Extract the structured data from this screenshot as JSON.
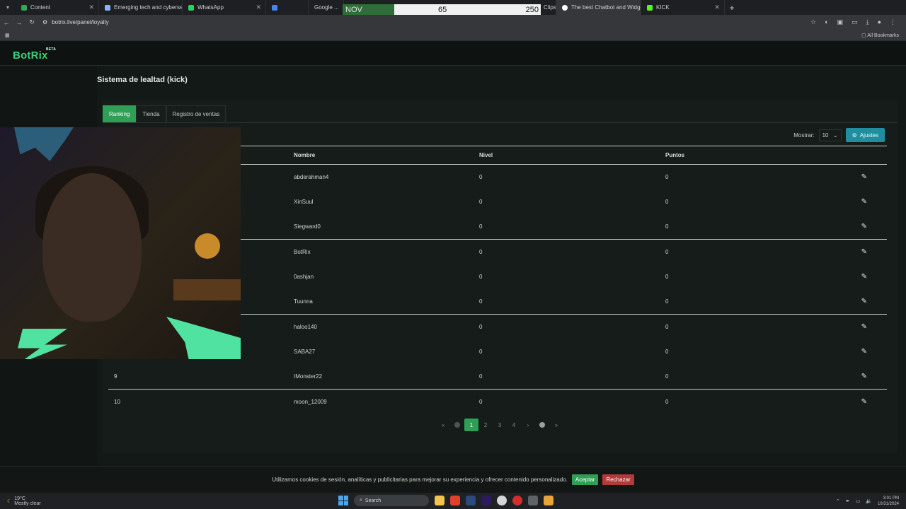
{
  "browser": {
    "tabs": [
      {
        "label": "Content",
        "color": "#34a853",
        "active": false
      },
      {
        "label": "Emerging tech and cybersecur...",
        "color": "#8ab4f8",
        "active": false
      },
      {
        "label": "WhatsApp",
        "color": "#25d366",
        "active": false
      },
      {
        "label": "",
        "color": "#4285f4",
        "active": false
      },
      {
        "label": "Google ...",
        "color": "#aaaaaa",
        "active": false
      },
      {
        "label": "Clips - Watch Live on ...",
        "color": "#53fc18",
        "active": false
      },
      {
        "label": "The best Chatbot and Widgets",
        "color": "#ffffff",
        "active": true
      },
      {
        "label": "KICK",
        "color": "#53fc18",
        "active": false
      }
    ],
    "url": "botrix.live/panel/loyalty",
    "all_bookmarks": "All Bookmarks"
  },
  "overlay": {
    "month": "NOV",
    "value_a": "65",
    "value_b": "250"
  },
  "app": {
    "logo": "BotRix",
    "logo_badge": "BETA"
  },
  "page": {
    "title": "Sistema de lealtad (kick)"
  },
  "tabs": [
    {
      "label": "Ranking",
      "active": true
    },
    {
      "label": "Tienda",
      "active": false
    },
    {
      "label": "Registro de ventas",
      "active": false
    }
  ],
  "controls": {
    "show_label": "Mostrar:",
    "show_value": "10",
    "settings_label": "Ajustes"
  },
  "table": {
    "headers": {
      "name": "Nombre",
      "level": "Nivel",
      "points": "Puntos"
    },
    "rows": [
      {
        "rank": "",
        "name": "abderahman4",
        "level": "0",
        "points": "0"
      },
      {
        "rank": "",
        "name": "XinSuul",
        "level": "0",
        "points": "0"
      },
      {
        "rank": "",
        "name": "Siegward0",
        "level": "0",
        "points": "0"
      },
      {
        "rank": "",
        "name": "BotRix",
        "level": "0",
        "points": "0"
      },
      {
        "rank": "",
        "name": "0ashjan",
        "level": "0",
        "points": "0"
      },
      {
        "rank": "",
        "name": "Tuunna",
        "level": "0",
        "points": "0"
      },
      {
        "rank": "",
        "name": "haloo140",
        "level": "0",
        "points": "0"
      },
      {
        "rank": "",
        "name": "SABA27",
        "level": "0",
        "points": "0"
      },
      {
        "rank": "9",
        "name": "IMonster22",
        "level": "0",
        "points": "0"
      },
      {
        "rank": "10",
        "name": "moon_12009",
        "level": "0",
        "points": "0"
      }
    ]
  },
  "pagination": {
    "first": "«",
    "prev": "‹",
    "pages": [
      "1",
      "2",
      "3",
      "4"
    ],
    "next": "›",
    "last": "»",
    "current": "1"
  },
  "cookie": {
    "text": "Utilizamos cookies de sesión, analíticas y publicitarias para mejorar su experiencia y ofrecer contenido personalizado.",
    "accept": "Aceptar",
    "reject": "Rechazar"
  },
  "taskbar": {
    "search": "Search",
    "weather": "19°C",
    "weather_sub": "Mostly clear",
    "time": "3:01 PM",
    "date": "10/31/2024"
  }
}
